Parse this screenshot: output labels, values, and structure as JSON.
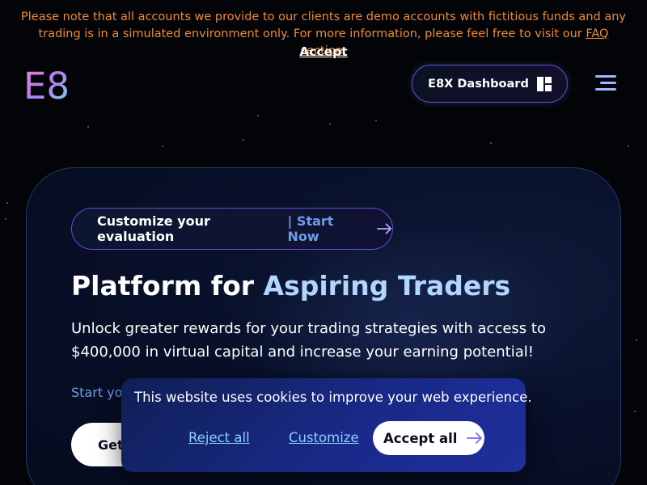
{
  "notice": {
    "text": "Please note that all accounts we provide to our clients are demo accounts with fictitious funds and any trading is in a simulated environment only. For more information, please feel free to visit our",
    "link_label": "FAQ section.",
    "accept_label": "Accept"
  },
  "header": {
    "logo_text": "E8",
    "dashboard_button_label": "E8X Dashboard",
    "dashboard_icon": "dashboard-grid-icon",
    "menu_icon": "hamburger-menu-icon"
  },
  "hero": {
    "pill_text": "Customize your evaluation",
    "pill_link": "| Start Now",
    "pill_icon": "arrow-right-icon",
    "title_part1": "Platform for",
    "title_part2": "Aspiring Traders",
    "subtitle": "Unlock greater rewards for your trading strategies with access to $400,000 in virtual capital and increase your earning potential!",
    "start_text": "Start yo",
    "cta_label": "Get"
  },
  "cookie_banner": {
    "text": "This website uses cookies to improve your web experience.",
    "reject_label": "Reject all",
    "customize_label": "Customize",
    "accept_label": "Accept all",
    "accept_icon": "arrow-right-icon"
  },
  "colors": {
    "background": "#030407",
    "notice_orange": "#f08a35",
    "accent_blue": "#6f9be8",
    "title_highlight": "#b3d6ff",
    "border_purple": "#6a4ad8",
    "cookie_link": "#8ad0ff"
  }
}
